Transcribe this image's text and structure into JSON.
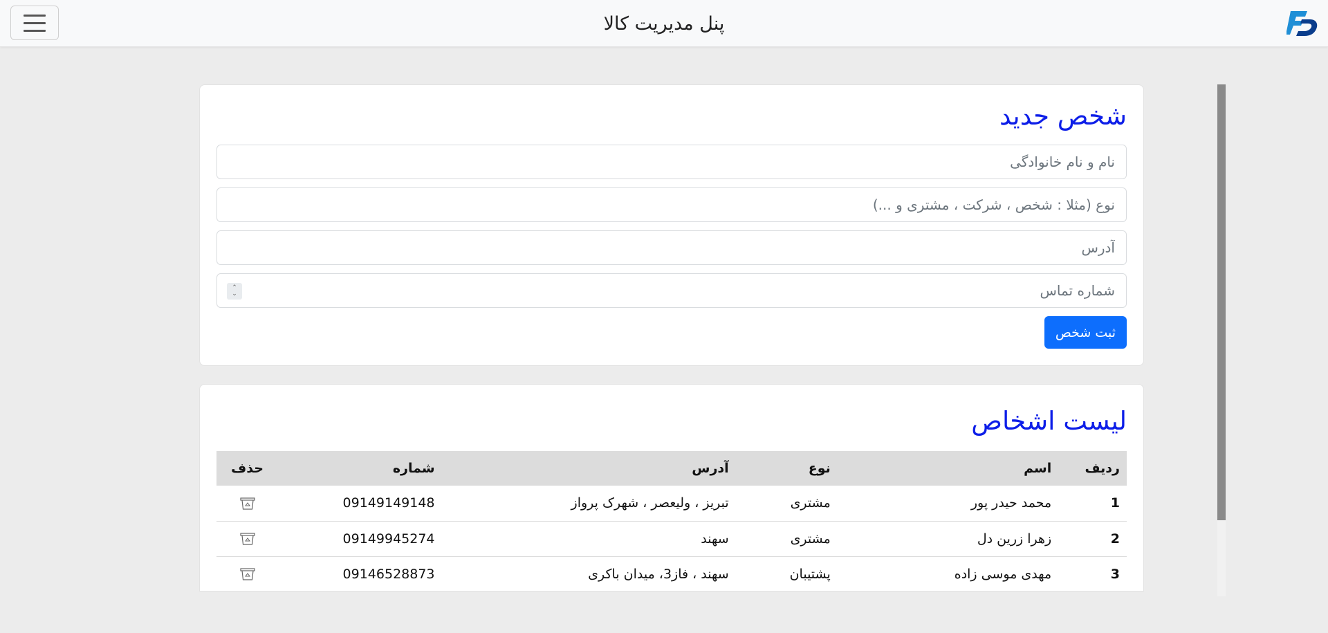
{
  "navbar": {
    "title": "پنل مدیریت کالا",
    "menu_icon": "hamburger-icon",
    "logo_icon": "brand-logo",
    "logo_colors": [
      "#1f8fd6",
      "#0a3d8c"
    ]
  },
  "form": {
    "title": "شخص جدید",
    "fields": {
      "name_placeholder": "نام و نام خانوادگی",
      "type_placeholder": "نوع (مثلا : شخص ، شرکت ، مشتری و ...)",
      "address_placeholder": "آدرس",
      "phone_placeholder": "شماره تماس"
    },
    "submit_label": "ثبت شخص"
  },
  "list": {
    "title": "لیست اشخاص",
    "headers": {
      "index": "ردیف",
      "name": "اسم",
      "type": "نوع",
      "address": "آدرس",
      "phone": "شماره",
      "delete": "حذف"
    },
    "rows": [
      {
        "index": "1",
        "name": "محمد حیدر پور",
        "type": "مشتری",
        "address": "تبریز ، ولیعصر ، شهرک پرواز",
        "phone": "09149149148"
      },
      {
        "index": "2",
        "name": "زهرا زرین دل",
        "type": "مشتری",
        "address": "سهند",
        "phone": "09149945274"
      },
      {
        "index": "3",
        "name": "مهدی موسی زاده",
        "type": "پشتیبان",
        "address": "سهند ، فاز3، میدان باکری",
        "phone": "09146528873"
      }
    ]
  },
  "colors": {
    "accent_title": "#0d1ee8",
    "primary_button": "#0d6efd"
  }
}
